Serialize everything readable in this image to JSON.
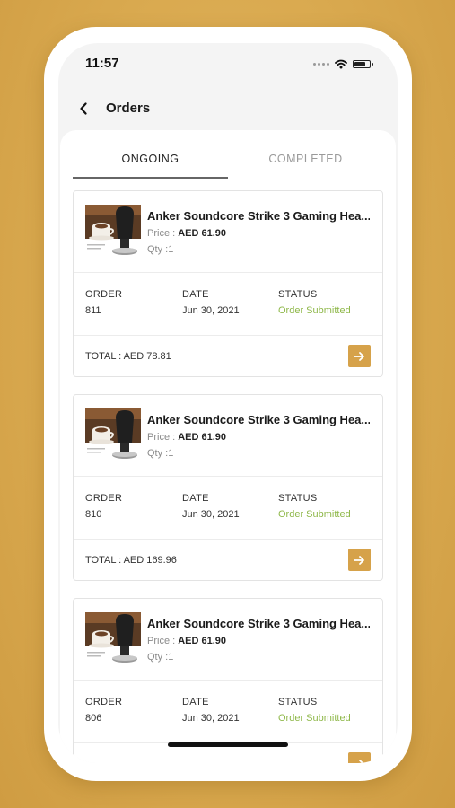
{
  "status_bar": {
    "time": "11:57"
  },
  "nav": {
    "title": "Orders"
  },
  "tabs": [
    {
      "label": "ONGOING",
      "active": true
    },
    {
      "label": "COMPLETED",
      "active": false
    }
  ],
  "labels": {
    "price": "Price : ",
    "order": "ORDER",
    "date": "DATE",
    "status": "STATUS"
  },
  "orders": [
    {
      "product_name": "Anker Soundcore Strike 3 Gaming Hea...",
      "price": "AED 61.90",
      "qty": "Qty :1",
      "order_no": "811",
      "date": "Jun 30, 2021",
      "status": "Order Submitted",
      "total": "TOTAL : AED 78.81"
    },
    {
      "product_name": "Anker Soundcore Strike 3 Gaming Hea...",
      "price": "AED 61.90",
      "qty": "Qty :1",
      "order_no": "810",
      "date": "Jun 30, 2021",
      "status": "Order Submitted",
      "total": "TOTAL : AED 169.96"
    },
    {
      "product_name": "Anker Soundcore Strike 3 Gaming Hea...",
      "price": "AED 61.90",
      "qty": "Qty :1",
      "order_no": "806",
      "date": "Jun 30, 2021",
      "status": "Order Submitted",
      "total": ""
    }
  ],
  "colors": {
    "accent": "#d6a24a",
    "status_green": "#8fb84a",
    "background": "#dcae55"
  },
  "icons": {
    "back": "chevron-left-icon",
    "go": "arrow-right-icon",
    "wifi": "wifi-icon",
    "battery": "battery-icon"
  }
}
